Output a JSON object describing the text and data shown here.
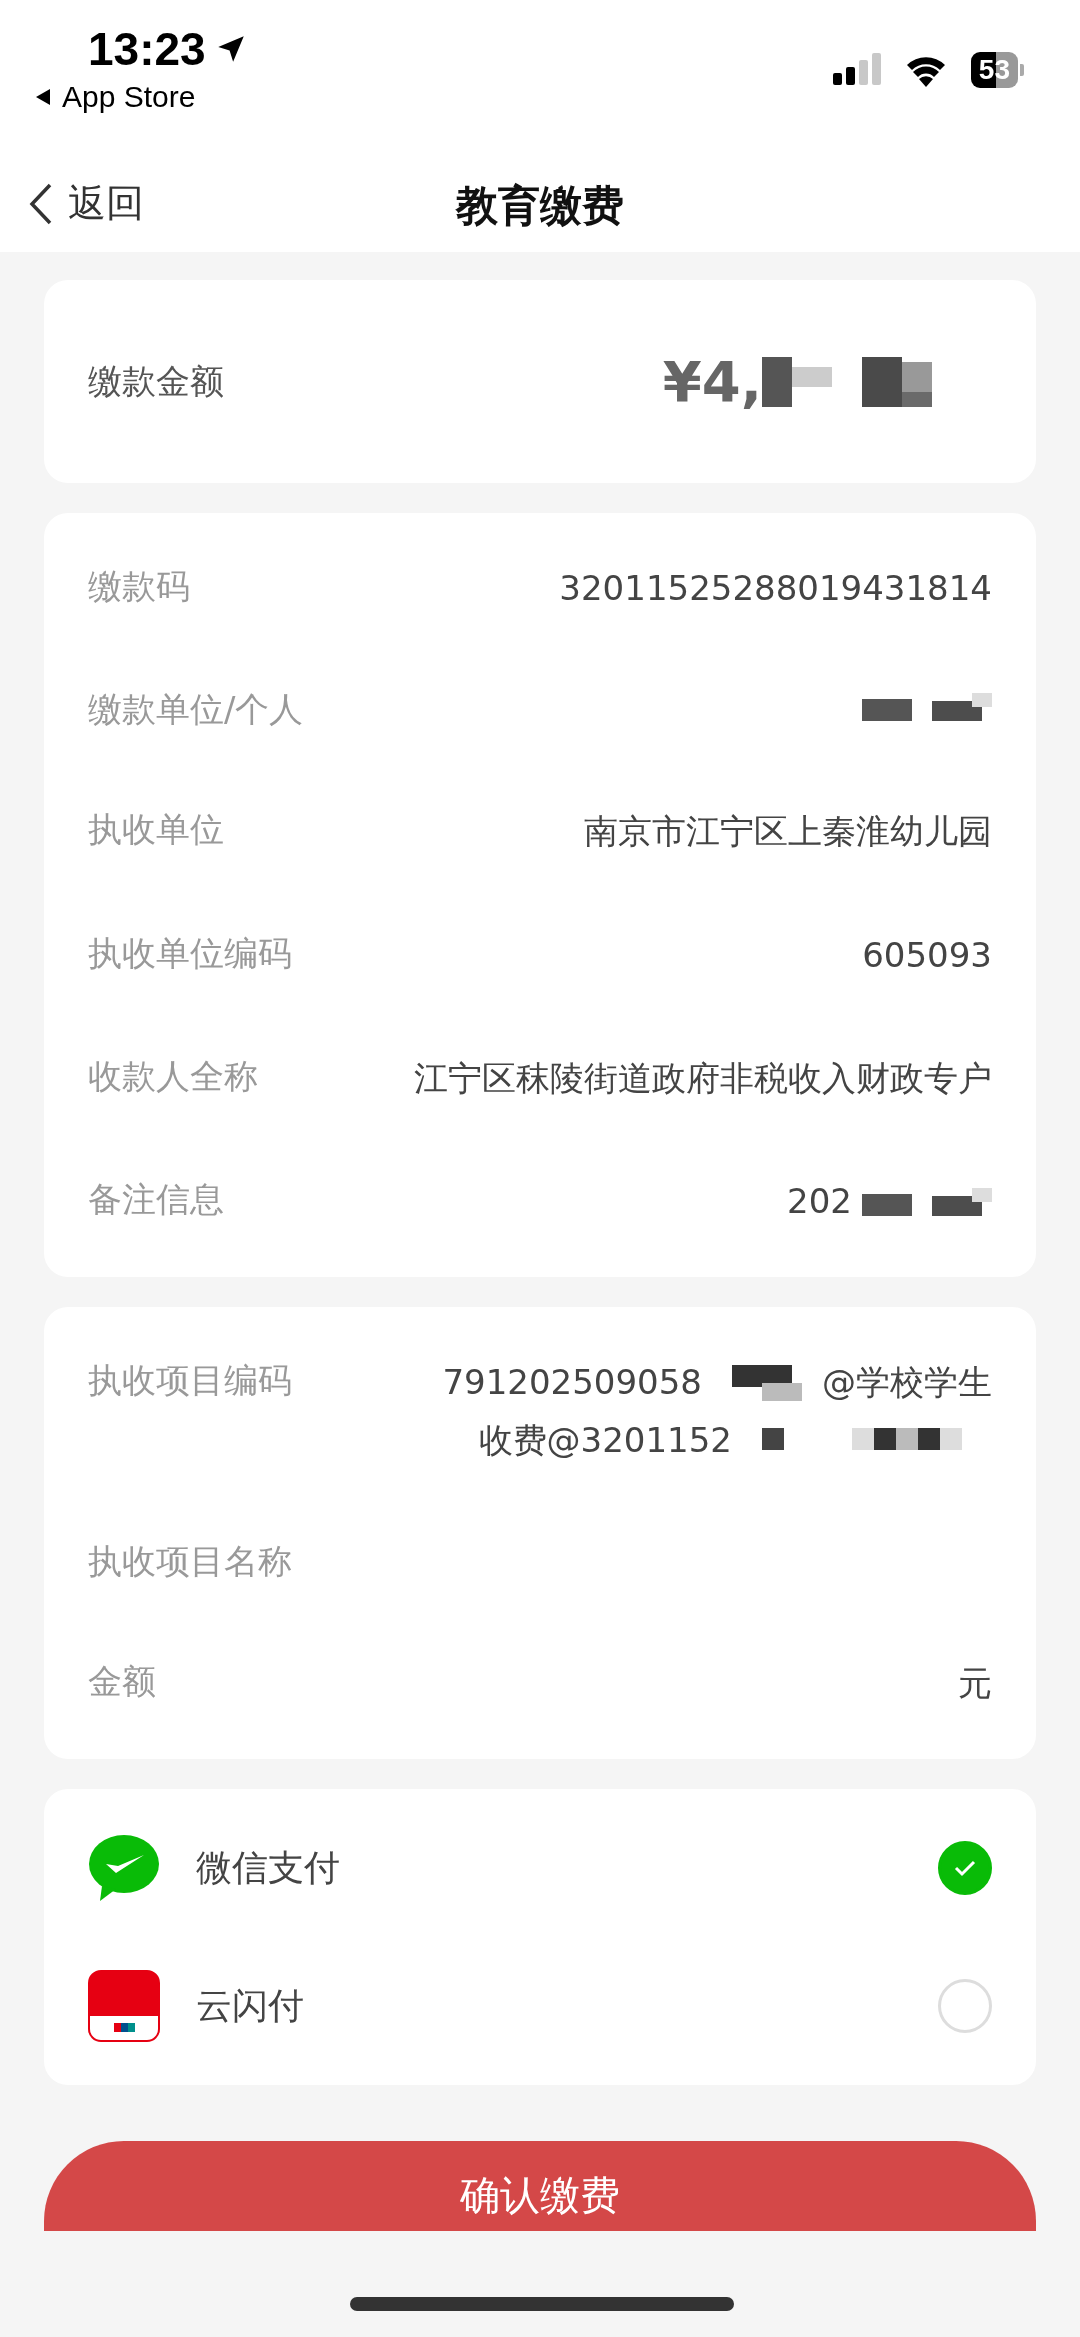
{
  "status_bar": {
    "time": "13:23",
    "back_app": "App Store",
    "battery": "53"
  },
  "nav": {
    "back": "返回",
    "title": "教育缴费"
  },
  "amount": {
    "label": "缴款金额",
    "value": "¥4,"
  },
  "details": [
    {
      "label": "缴款码",
      "value": "3201152528801943181​4"
    },
    {
      "label": "缴款单位/个人",
      "redacted": true
    },
    {
      "label": "执收单位",
      "value": "南京市江宁区上秦淮幼儿园"
    },
    {
      "label": "执收单位编码",
      "value": "605093"
    },
    {
      "label": "收款人全称",
      "value": "江宁区秣陵街道政府非税收入财政专户"
    },
    {
      "label": "备注信息",
      "value": "202",
      "redacted": true
    }
  ],
  "items": [
    {
      "label": "执收项目编码",
      "lines": [
        "791202509058",
        "@学校学生",
        "收费@3201152"
      ],
      "redacted": true
    },
    {
      "label": "执收项目名称"
    },
    {
      "label": "金额",
      "value": "元"
    }
  ],
  "payment_methods": [
    {
      "kind": "wechat",
      "label": "微信支付",
      "selected": true
    },
    {
      "kind": "unionpay",
      "label": "云闪付",
      "selected": false
    }
  ],
  "confirm_button": "确认缴费"
}
